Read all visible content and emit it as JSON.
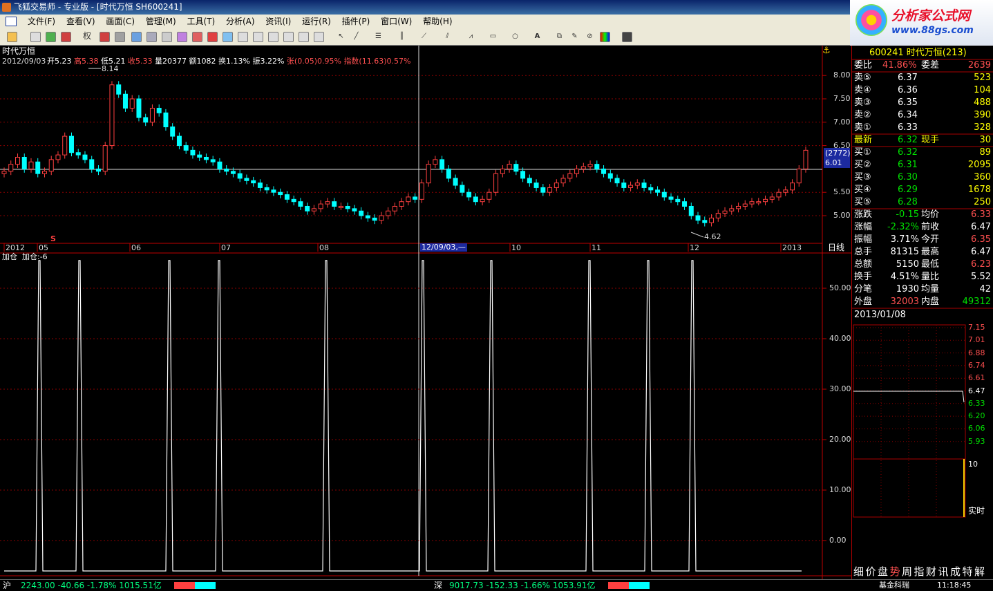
{
  "window": {
    "title": "飞狐交易师 - 专业版 - [时代万恒 SH600241]"
  },
  "menu": [
    "文件(F)",
    "查看(V)",
    "画面(C)",
    "管理(M)",
    "工具(T)",
    "分析(A)",
    "资讯(I)",
    "运行(R)",
    "插件(P)",
    "窗口(W)",
    "帮助(H)"
  ],
  "toolbar": {
    "rights_label": "权"
  },
  "logo": {
    "title": "分析家公式网",
    "url": "www.88gs.com"
  },
  "main_chart": {
    "stock_name": "时代万恒",
    "info_date": "2012/09/03",
    "info_line": [
      {
        "text": "开5.23",
        "color": "#ffffff"
      },
      {
        "text": "高5.38",
        "color": "#ff5050"
      },
      {
        "text": "低5.21",
        "color": "#ffffff"
      },
      {
        "text": "收5.33",
        "color": "#ff5050"
      },
      {
        "text": "量20377",
        "color": "#ffffff"
      },
      {
        "text": "额1082",
        "color": "#ffffff"
      },
      {
        "text": "换1.13%",
        "color": "#ffffff"
      },
      {
        "text": "振3.22%",
        "color": "#ffffff"
      },
      {
        "text": "张(0.05)0.95%",
        "color": "#ff5050"
      },
      {
        "text": "指数(11.63)0.57%",
        "color": "#ff5050"
      }
    ],
    "high_mark": "8.14",
    "low_mark": "4.62",
    "crosshair_price_tag": "(2772)",
    "crosshair_price": "6.01",
    "y_ticks": [
      "8.00",
      "7.50",
      "7.00",
      "6.50",
      "5.50",
      "5.00"
    ],
    "x_ticks": [
      "2012",
      "05",
      "06",
      "07",
      "08",
      "10",
      "11",
      "12",
      "2013"
    ],
    "crosshair_date": "12/09/03,—",
    "period_label": "日线",
    "marker_s": "S"
  },
  "indicator": {
    "name": "加仓",
    "value_label": "加仓:-6",
    "y_ticks": [
      "50.00",
      "40.00",
      "30.00",
      "20.00",
      "10.00",
      "0.00"
    ],
    "y_values": [
      50,
      40,
      30,
      20,
      10,
      0
    ],
    "spikes_x": [
      57,
      115,
      245,
      317,
      472,
      612,
      711,
      853,
      938,
      1002
    ]
  },
  "quote": {
    "title": "600241 时代万恒(213)",
    "weibi": {
      "label": "委比",
      "value": "41.86%",
      "label2": "委差",
      "value2": "2639"
    },
    "asks": [
      {
        "label": "卖⑤",
        "price": "6.37",
        "vol": "523"
      },
      {
        "label": "卖④",
        "price": "6.36",
        "vol": "104"
      },
      {
        "label": "卖③",
        "price": "6.35",
        "vol": "488"
      },
      {
        "label": "卖②",
        "price": "6.34",
        "vol": "390"
      },
      {
        "label": "卖①",
        "price": "6.33",
        "vol": "328"
      }
    ],
    "latest": {
      "label": "最新",
      "price": "6.32",
      "label2": "现手",
      "vol": "30"
    },
    "bids": [
      {
        "label": "买①",
        "price": "6.32",
        "vol": "89"
      },
      {
        "label": "买②",
        "price": "6.31",
        "vol": "2095"
      },
      {
        "label": "买③",
        "price": "6.30",
        "vol": "360"
      },
      {
        "label": "买④",
        "price": "6.29",
        "vol": "1678"
      },
      {
        "label": "买⑤",
        "price": "6.28",
        "vol": "250"
      }
    ],
    "stats": [
      {
        "l1": "涨跌",
        "v1": "-0.15",
        "c1": "#00e000",
        "l2": "均价",
        "v2": "6.33",
        "c2": "#ff5050"
      },
      {
        "l1": "涨幅",
        "v1": "-2.32%",
        "c1": "#00e000",
        "l2": "前收",
        "v2": "6.47",
        "c2": "#ffffff"
      },
      {
        "l1": "振幅",
        "v1": "3.71%",
        "c1": "#ffffff",
        "l2": "今开",
        "v2": "6.35",
        "c2": "#ff5050"
      },
      {
        "l1": "总手",
        "v1": "81315",
        "c1": "#ffffff",
        "l2": "最高",
        "v2": "6.47",
        "c2": "#ffffff"
      },
      {
        "l1": "总额",
        "v1": "5150",
        "c1": "#ffffff",
        "l2": "最低",
        "v2": "6.23",
        "c2": "#ff5050"
      },
      {
        "l1": "换手",
        "v1": "4.51%",
        "c1": "#ffffff",
        "l2": "量比",
        "v2": "5.52",
        "c2": "#ffffff"
      },
      {
        "l1": "分笔",
        "v1": "1930",
        "c1": "#ffffff",
        "l2": "均量",
        "v2": "42",
        "c2": "#ffffff"
      },
      {
        "l1": "外盘",
        "v1": "32003",
        "c1": "#ff5050",
        "l2": "内盘",
        "v2": "49312",
        "c2": "#00e000"
      }
    ],
    "minute_date": "2013/01/08",
    "minute_prices": [
      "7.15",
      "7.01",
      "6.88",
      "6.74",
      "6.61",
      "6.47",
      "6.33",
      "6.20",
      "6.06",
      "5.93"
    ],
    "minute_vol_tick": "10",
    "realtime_label": "实时",
    "bottom_tabs": [
      {
        "text": "细",
        "color": "#ffffff"
      },
      {
        "text": "价",
        "color": "#ffffff"
      },
      {
        "text": "盘",
        "color": "#ffffff"
      },
      {
        "text": "势",
        "color": "#ff5050"
      },
      {
        "text": "周",
        "color": "#ffffff"
      },
      {
        "text": "指",
        "color": "#ffffff"
      },
      {
        "text": "财",
        "color": "#ffffff"
      },
      {
        "text": "讯",
        "color": "#ffffff"
      },
      {
        "text": "成",
        "color": "#ffffff"
      },
      {
        "text": "特",
        "color": "#ffffff"
      },
      {
        "text": "解",
        "color": "#ffffff"
      }
    ]
  },
  "status": {
    "sh_label": "沪",
    "sh_values": "2243.00 -40.66 -1.78% 1015.51亿",
    "sz_label": "深",
    "sz_values": "9017.73 -152.33 -1.66% 1053.91亿",
    "fund": "基金科瑞",
    "time": "11:18:45"
  },
  "colors": {
    "up": "#ff4040",
    "down": "#00ffff",
    "grid": "#8a0000",
    "axis": "#c00000",
    "text_white": "#ffffff",
    "yellow": "#ffff00"
  }
}
